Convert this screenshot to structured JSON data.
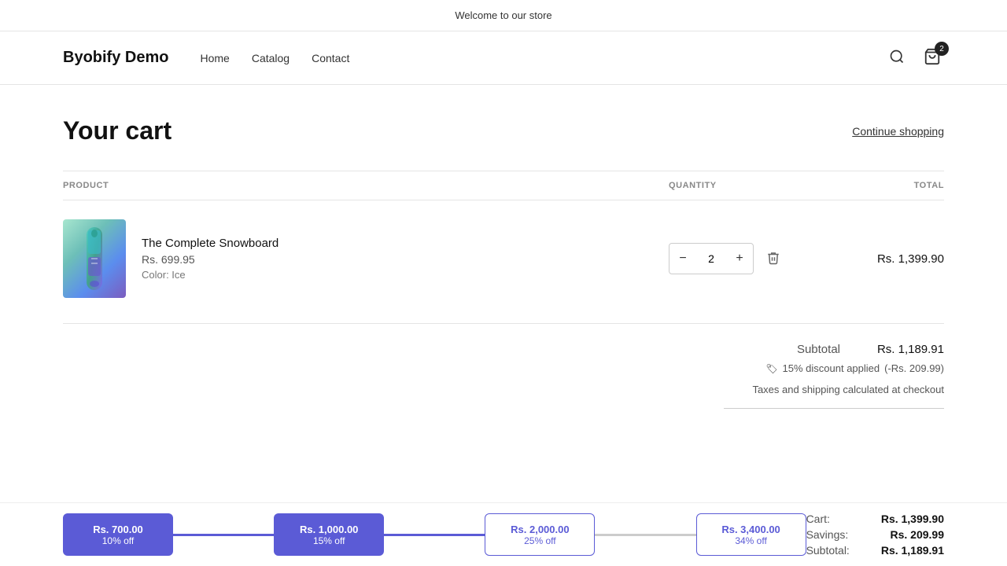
{
  "banner": {
    "text": "Welcome to our store"
  },
  "header": {
    "logo": "Byobify Demo",
    "nav": [
      "Home",
      "Catalog",
      "Contact"
    ],
    "cart_count": "2"
  },
  "cart": {
    "title": "Your cart",
    "continue_shopping": "Continue shopping",
    "columns": {
      "product": "PRODUCT",
      "quantity": "QUANTITY",
      "total": "TOTAL"
    },
    "items": [
      {
        "name": "The Complete Snowboard",
        "price": "Rs. 699.95",
        "color": "Color: Ice",
        "quantity": "2",
        "line_total": "Rs. 1,399.90"
      }
    ]
  },
  "summary": {
    "subtotal_label": "Subtotal",
    "subtotal_value": "Rs. 1,189.91",
    "discount_label": "15% discount applied",
    "discount_value": "(-Rs. 209.99)",
    "taxes_note": "Taxes and shipping calculated at checkout",
    "cart_label": "Cart:",
    "cart_value": "Rs. 1,399.90",
    "savings_label": "Savings:",
    "savings_value": "Rs. 209.99",
    "subtotal2_label": "Subtotal:",
    "subtotal2_value": "Rs. 1,189.91"
  },
  "tiers": [
    {
      "amount": "Rs. 700.00",
      "discount": "10% off",
      "state": "active"
    },
    {
      "amount": "Rs. 1,000.00",
      "discount": "15% off",
      "state": "active"
    },
    {
      "amount": "Rs. 2,000.00",
      "discount": "25% off",
      "state": "inactive"
    },
    {
      "amount": "Rs. 3,400.00",
      "discount": "34% off",
      "state": "inactive"
    }
  ]
}
